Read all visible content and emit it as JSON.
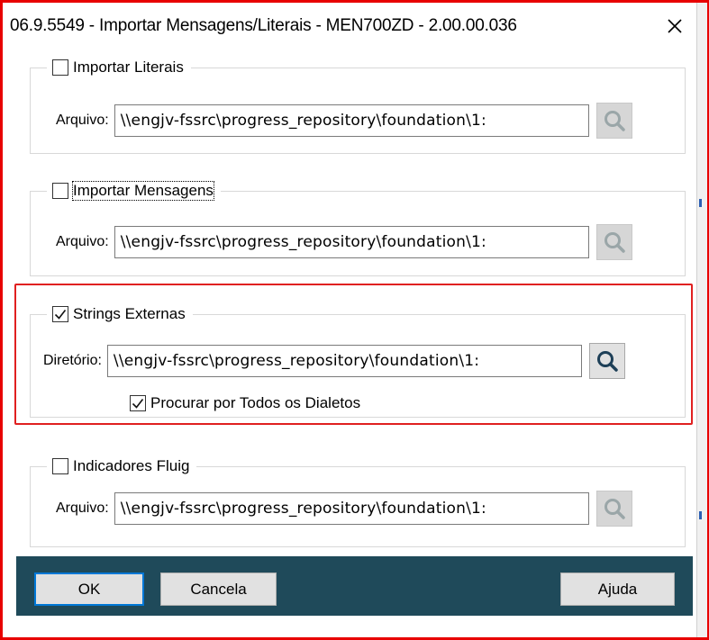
{
  "window": {
    "title": "06.9.5549 - Importar Mensagens/Literais - MEN700ZD - 2.00.00.036",
    "close_symbol": "✕"
  },
  "groups": {
    "literais": {
      "label": "Importar Literais",
      "checked": false,
      "field_label": "Arquivo:",
      "path": "\\\\engjv-fssrc\\progress_repository\\foundation\\1:",
      "search_enabled": false
    },
    "mensagens": {
      "label": "Importar Mensagens",
      "checked": false,
      "field_label": "Arquivo:",
      "path": "\\\\engjv-fssrc\\progress_repository\\foundation\\1:",
      "search_enabled": false
    },
    "strings": {
      "label": "Strings Externas",
      "checked": true,
      "field_label": "Diretório:",
      "path": "\\\\engjv-fssrc\\progress_repository\\foundation\\1:",
      "search_enabled": true,
      "sub_option_label": "Procurar por Todos os Dialetos",
      "sub_option_checked": true
    },
    "fluig": {
      "label": "Indicadores Fluig",
      "checked": false,
      "field_label": "Arquivo:",
      "path": "\\\\engjv-fssrc\\progress_repository\\foundation\\1:",
      "search_enabled": false
    }
  },
  "footer": {
    "ok_label": "OK",
    "cancel_label": "Cancela",
    "help_label": "Ajuda"
  },
  "colors": {
    "highlight": "#e02020",
    "footer_bg": "#1f4a5a",
    "search_icon_enabled": "#1d3f57",
    "search_icon_disabled": "#9aa6a8"
  }
}
